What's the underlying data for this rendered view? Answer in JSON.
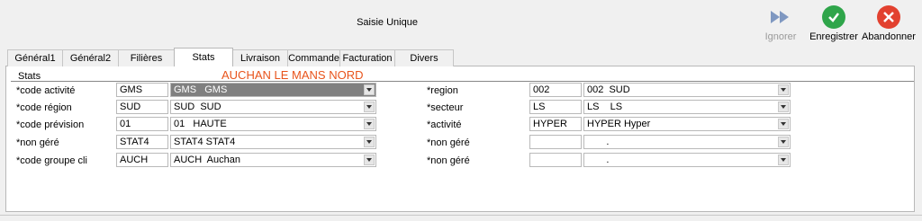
{
  "window": {
    "title": "Saisie Unique"
  },
  "toolbar": {
    "ignore_label": "Ignorer",
    "save_label": "Enregistrer",
    "cancel_label": "Abandonner",
    "save_color": "#2fa54a",
    "cancel_color": "#e2412f"
  },
  "tabs": [
    "Général1",
    "Général2",
    "Filières",
    "Stats",
    "Livraison",
    "Commande",
    "Facturation",
    "Divers"
  ],
  "active_tab": "Stats",
  "section": {
    "title": "Stats",
    "company": "AUCHAN LE MANS NORD"
  },
  "left_fields": [
    {
      "label": "*code activité",
      "code": "GMS",
      "value": "GMS   GMS"
    },
    {
      "label": "*code région",
      "code": "SUD",
      "value": "SUD  SUD"
    },
    {
      "label": "*code prévision",
      "code": "01",
      "value": "01   HAUTE"
    },
    {
      "label": "*non géré",
      "code": "STAT4",
      "value": "STAT4 STAT4"
    },
    {
      "label": "*code groupe cli",
      "code": "AUCH",
      "value": "AUCH  Auchan"
    }
  ],
  "right_fields": [
    {
      "label": "*region",
      "code": "002",
      "value": "002  SUD"
    },
    {
      "label": "*secteur",
      "code": "LS",
      "value": "LS    LS"
    },
    {
      "label": "*activité",
      "code": "HYPER",
      "value": "HYPER Hyper"
    },
    {
      "label": "*non géré",
      "code": "",
      "value": "       ."
    },
    {
      "label": "*non géré",
      "code": "",
      "value": "       ."
    }
  ]
}
